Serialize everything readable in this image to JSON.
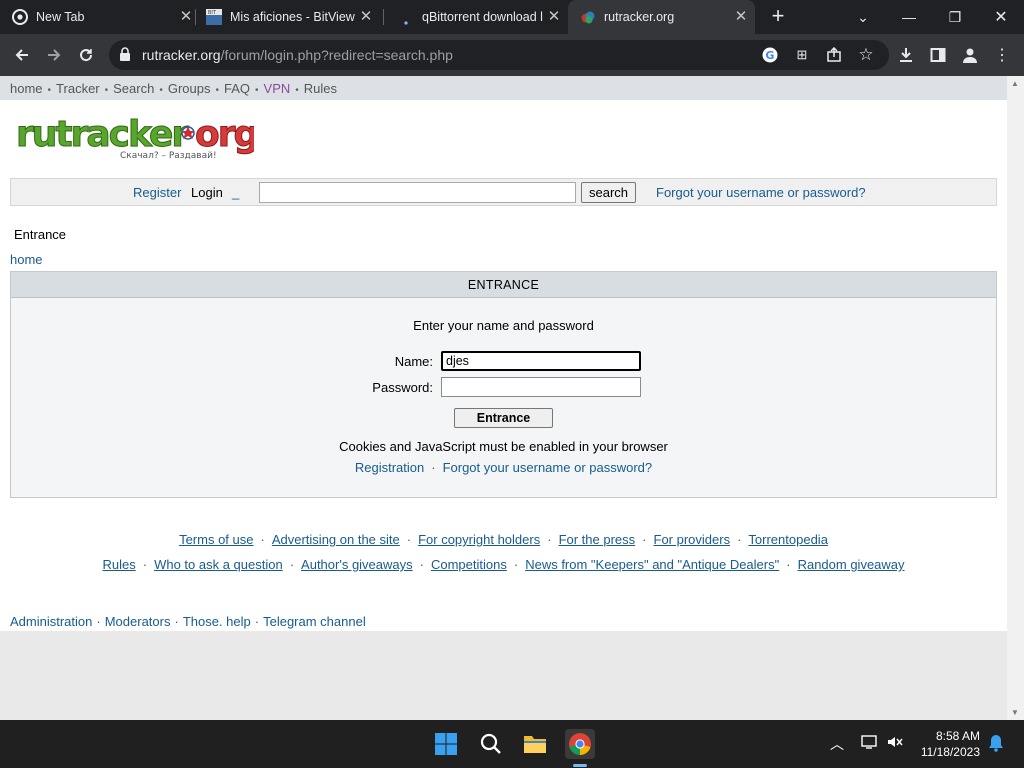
{
  "browser": {
    "tabs": [
      {
        "title": "New Tab",
        "icon": "chrome-icon",
        "active": false
      },
      {
        "title": "Mis aficiones - BitView",
        "icon": "bitview-icon",
        "active": false
      },
      {
        "title": "qBittorrent download l",
        "icon": "loading-icon",
        "active": false
      },
      {
        "title": "rutracker.org",
        "icon": "rutracker-icon",
        "active": true
      }
    ],
    "url_host": "rutracker.org",
    "url_path": "/forum/login.php?redirect=search.php"
  },
  "topnav": {
    "items": [
      "home",
      "Tracker",
      "Search",
      "Groups",
      "FAQ",
      "VPN",
      "Rules"
    ]
  },
  "logo": {
    "text": "rutracker.org",
    "slogan": "Скачал? – Раздавай!"
  },
  "loginbar": {
    "register": "Register",
    "login": "Login",
    "underscore": "_",
    "search_button": "search",
    "forgot": "Forgot your username or password?"
  },
  "breadcrumb": {
    "title": "Entrance",
    "home": "home"
  },
  "form": {
    "header": "ENTRANCE",
    "prompt": "Enter your name and password",
    "name_label": "Name:",
    "name_value": "djes",
    "password_label": "Password:",
    "submit": "Entrance",
    "notice": "Cookies and JavaScript must be enabled in your browser",
    "registration": "Registration",
    "forgot": "Forgot your username or password?"
  },
  "footer": {
    "row1": [
      "Terms of use",
      "Advertising on the site",
      "For copyright holders",
      "For the press",
      "For providers",
      "Torrentopedia"
    ],
    "row2": [
      "Rules",
      "Who to ask a question",
      "Author's giveaways",
      "Competitions",
      "News from \"Keepers\" and \"Antique Dealers\"",
      "Random giveaway"
    ],
    "row3": [
      "Administration",
      "Moderators",
      "Those. help",
      "Telegram channel"
    ]
  },
  "taskbar": {
    "time": "8:58 AM",
    "date": "11/18/2023"
  },
  "colors": {
    "link": "#185c8e",
    "tabbar": "#202124",
    "toolbar": "#35363a",
    "vpn": "#8b4b9a"
  }
}
